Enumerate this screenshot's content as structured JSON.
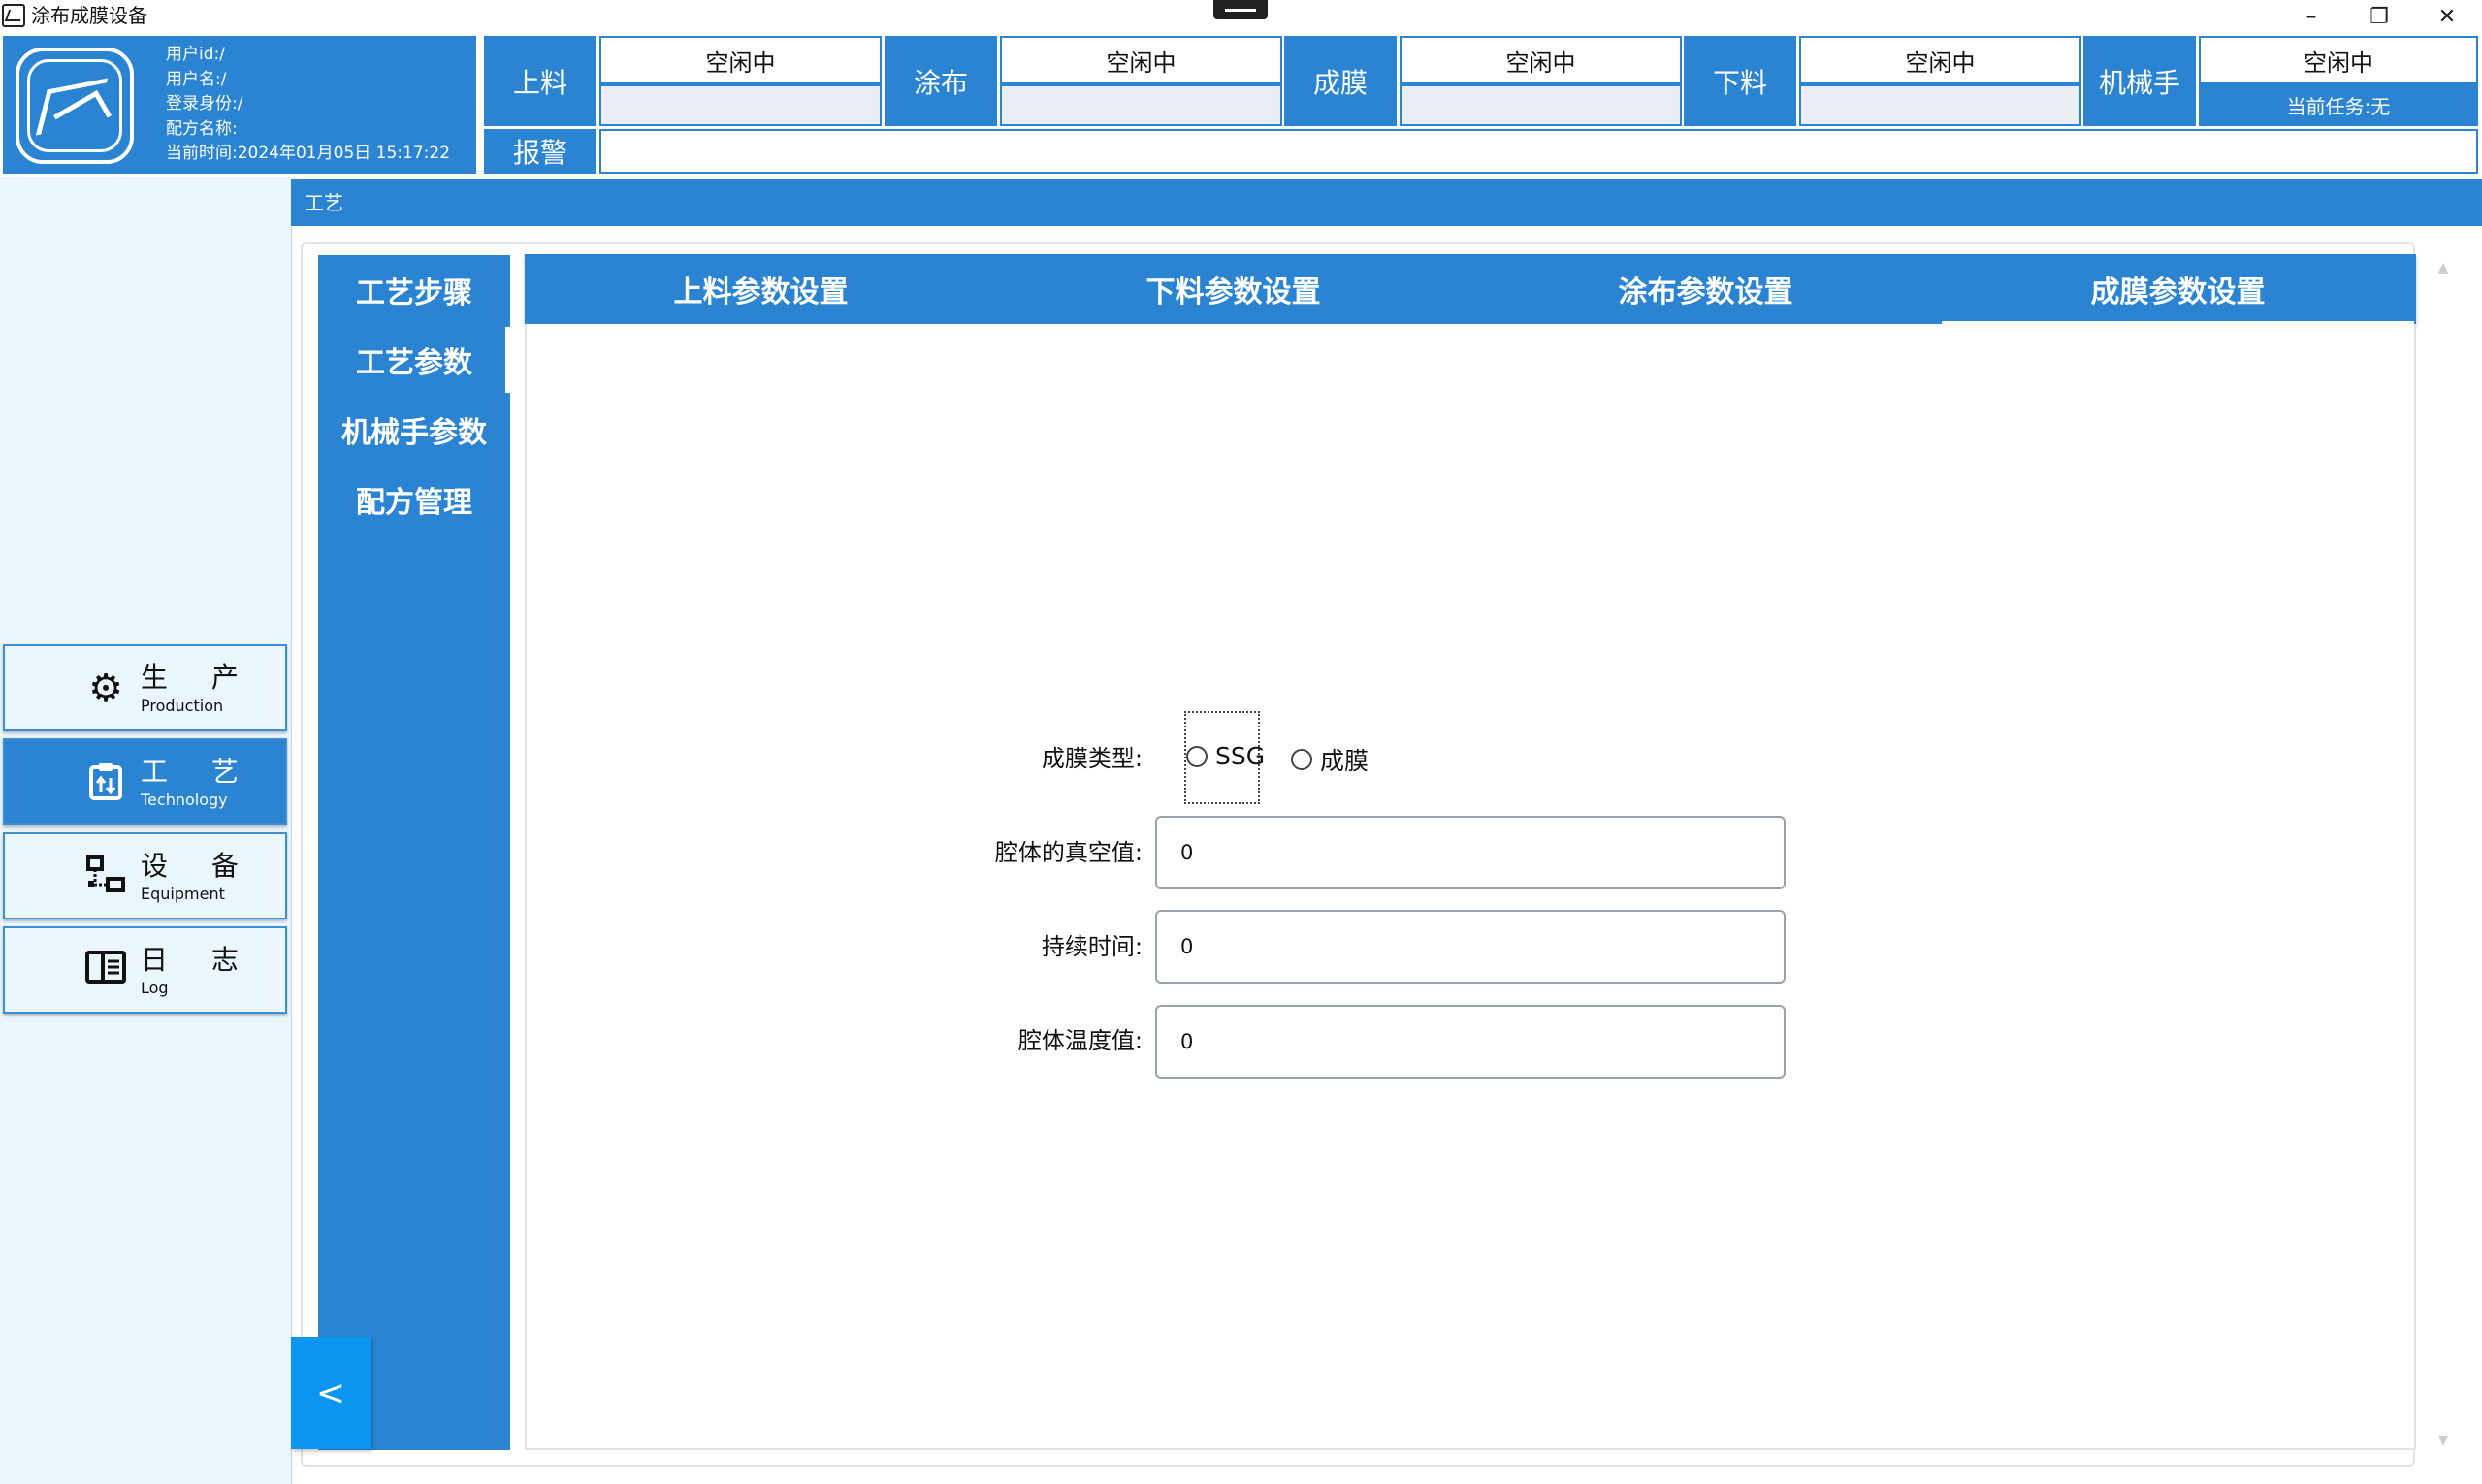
{
  "window": {
    "title": "涂布成膜设备",
    "minimize_icon": "minimize-icon",
    "maximize_icon": "restore-icon",
    "close_icon": "close-icon"
  },
  "user_info": {
    "user_id": "用户id:/",
    "user_name": "用户名:/",
    "login_role": "登录身份:/",
    "recipe_name": "配方名称:",
    "current_time": "当前时间:2024年01月05日 15:17:22"
  },
  "stations": [
    {
      "label": "上料",
      "status": "空闲中"
    },
    {
      "label": "涂布",
      "status": "空闲中"
    },
    {
      "label": "成膜",
      "status": "空闲中"
    },
    {
      "label": "下料",
      "status": "空闲中"
    },
    {
      "label": "机械手",
      "status": "空闲中",
      "task": "当前任务:无"
    }
  ],
  "alarm": {
    "label": "报警"
  },
  "nav": [
    {
      "cn": "生 产",
      "en": "Production",
      "icon": "gear-icon"
    },
    {
      "cn": "工 艺",
      "en": "Technology",
      "icon": "clipboard-icon"
    },
    {
      "cn": "设 备",
      "en": "Equipment",
      "icon": "network-icon"
    },
    {
      "cn": "日 志",
      "en": "Log",
      "icon": "book-icon"
    }
  ],
  "content": {
    "header": "工艺",
    "subnav": [
      "工艺步骤",
      "工艺参数",
      "机械手参数",
      "配方管理"
    ],
    "tabs": [
      "上料参数设置",
      "下料参数设置",
      "涂布参数设置",
      "成膜参数设置"
    ],
    "form": {
      "film_type_label": "成膜类型:",
      "film_type_options": [
        "SSG",
        "成膜"
      ],
      "vacuum_label": "腔体的真空值:",
      "vacuum_value": "0",
      "duration_label": "持续时间:",
      "duration_value": "0",
      "temperature_label": "腔体温度值:",
      "temperature_value": "0"
    },
    "collapse_label": "<"
  },
  "colors": {
    "primary": "#2a84d2",
    "nav_bg": "#eaf5fc",
    "collapse_button": "#0a96f0"
  }
}
